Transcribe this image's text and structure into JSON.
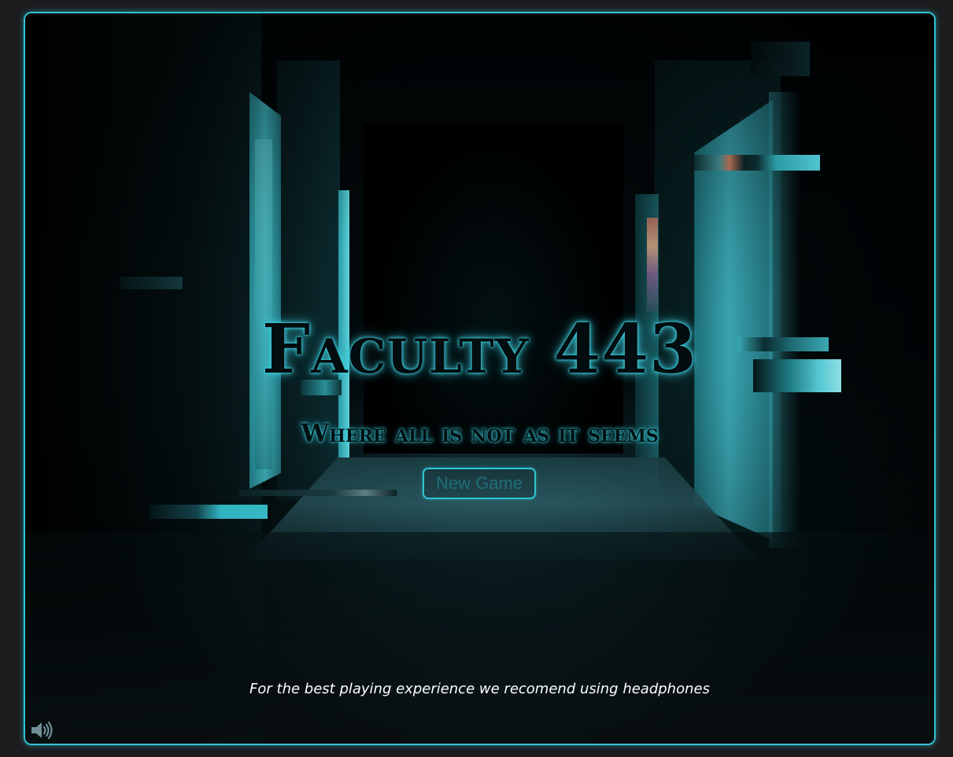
{
  "game": {
    "title": "Faculty 443",
    "subtitle": "Where all is not as it seems",
    "new_game_label": "New Game",
    "headphones_hint": "For the best playing experience we recomend using headphones",
    "sound_icon": "speaker-volume-icon"
  },
  "theme": {
    "accent": "#2fc4d4",
    "background": "#1c1c1e",
    "button_text": "#1f6e78",
    "hint_text": "#ffffff"
  }
}
